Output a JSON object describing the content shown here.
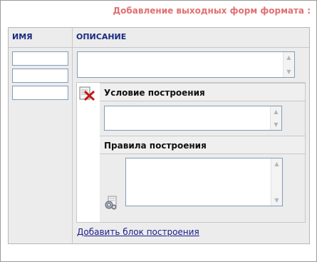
{
  "header": {
    "title": "Добавление выходных форм формата :"
  },
  "table": {
    "columns": {
      "name": "ИМЯ",
      "description": "ОПИСАНИЕ"
    }
  },
  "block": {
    "condition_label": "Условие построения",
    "rules_label": "Правила построения"
  },
  "add_block_link": "Добавить блок построения",
  "icons": {
    "delete": "delete-icon",
    "rules": "gear-document-icon",
    "scroll_up": "▲",
    "scroll_down": "▼"
  },
  "colors": {
    "title": "#e07070",
    "header_text": "#1a2a80",
    "link": "#1a1a8c"
  }
}
